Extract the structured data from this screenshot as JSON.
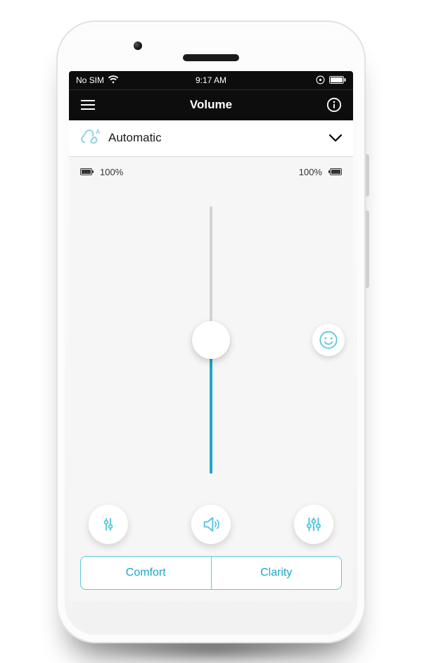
{
  "status": {
    "carrier": "No SIM",
    "time": "9:17 AM"
  },
  "nav": {
    "title": "Volume"
  },
  "program": {
    "label": "Automatic"
  },
  "battery": {
    "left": "100%",
    "right": "100%"
  },
  "slider": {
    "value_pct": 50
  },
  "segments": {
    "comfort": "Comfort",
    "clarity": "Clarity"
  },
  "colors": {
    "accent": "#1ca6c9"
  }
}
